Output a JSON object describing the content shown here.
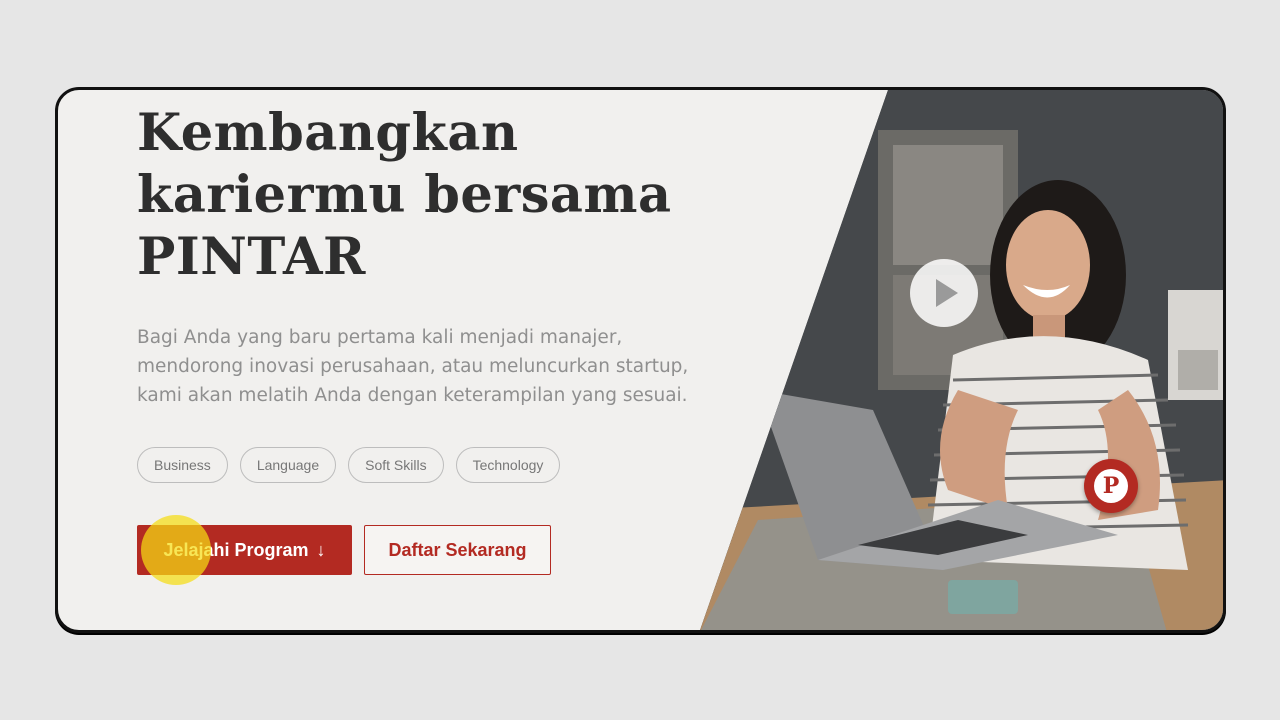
{
  "hero": {
    "title_lines": [
      "Kembangkan",
      "kariermu bersama",
      "PINTAR"
    ],
    "description_lines": [
      "Bagi Anda yang baru pertama kali menjadi manajer,",
      "mendorong inovasi perusahaan, atau meluncurkan startup,",
      "kami akan melatih Anda dengan keterampilan yang sesuai."
    ],
    "tags": [
      "Business",
      "Language",
      "Soft Skills",
      "Technology"
    ],
    "primary_button": {
      "label": "Jelajahi Program",
      "icon": "arrow-down-icon",
      "arrow": "↓"
    },
    "secondary_button": {
      "label": "Daftar Sekarang"
    },
    "video": {
      "icon": "play-icon"
    },
    "brand_badge": {
      "letter": "P",
      "icon": "brand-logo-icon"
    }
  },
  "colors": {
    "accent": "#b32a22",
    "title": "#2e2e2e",
    "body_text": "#8f8f8f",
    "background": "#f1f0ee",
    "cursor_highlight": "#f5dc14"
  }
}
